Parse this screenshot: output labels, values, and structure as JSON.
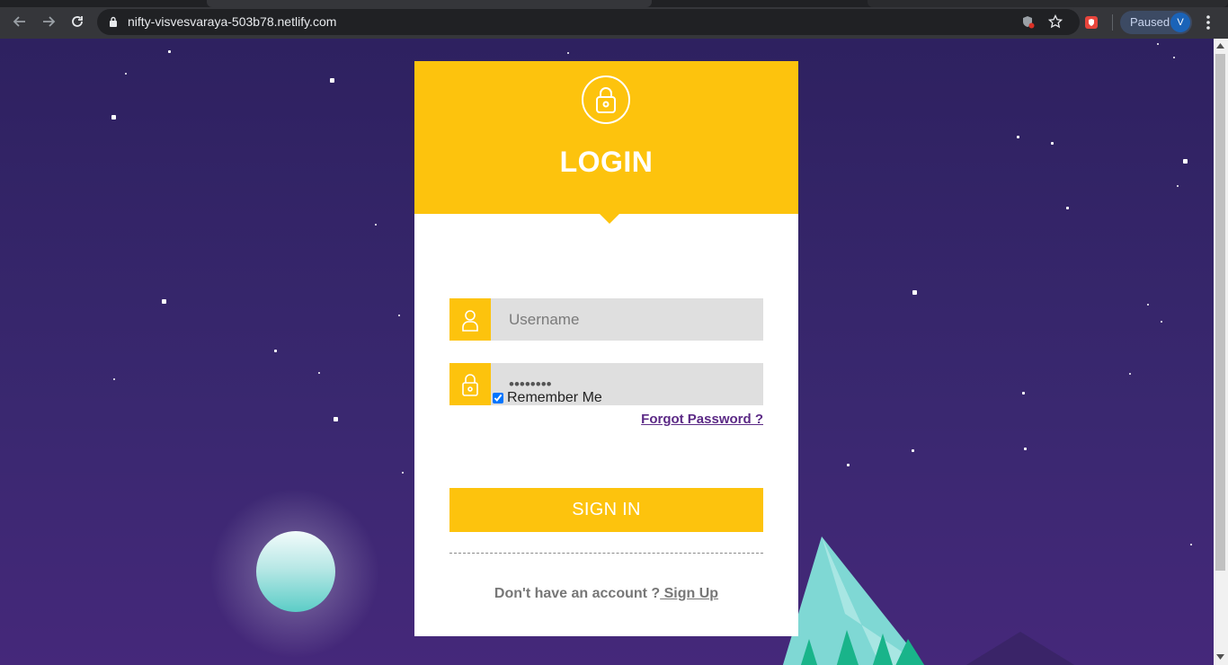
{
  "browser": {
    "url": "nifty-visvesvaraya-503b78.netlify.com",
    "profile_status": "Paused",
    "profile_initial": "V"
  },
  "login": {
    "title": "LOGIN",
    "username_placeholder": "Username",
    "password_value": "password",
    "remember_label": "Remember Me",
    "remember_checked": true,
    "forgot_label": "Forgot Password ?",
    "signin_label": "SIGN IN",
    "no_account_text": "Don't have an account ?",
    "signup_label": " Sign Up"
  },
  "colors": {
    "accent": "#fdc30d",
    "background": "#2f2460",
    "link": "#5c2a86"
  }
}
